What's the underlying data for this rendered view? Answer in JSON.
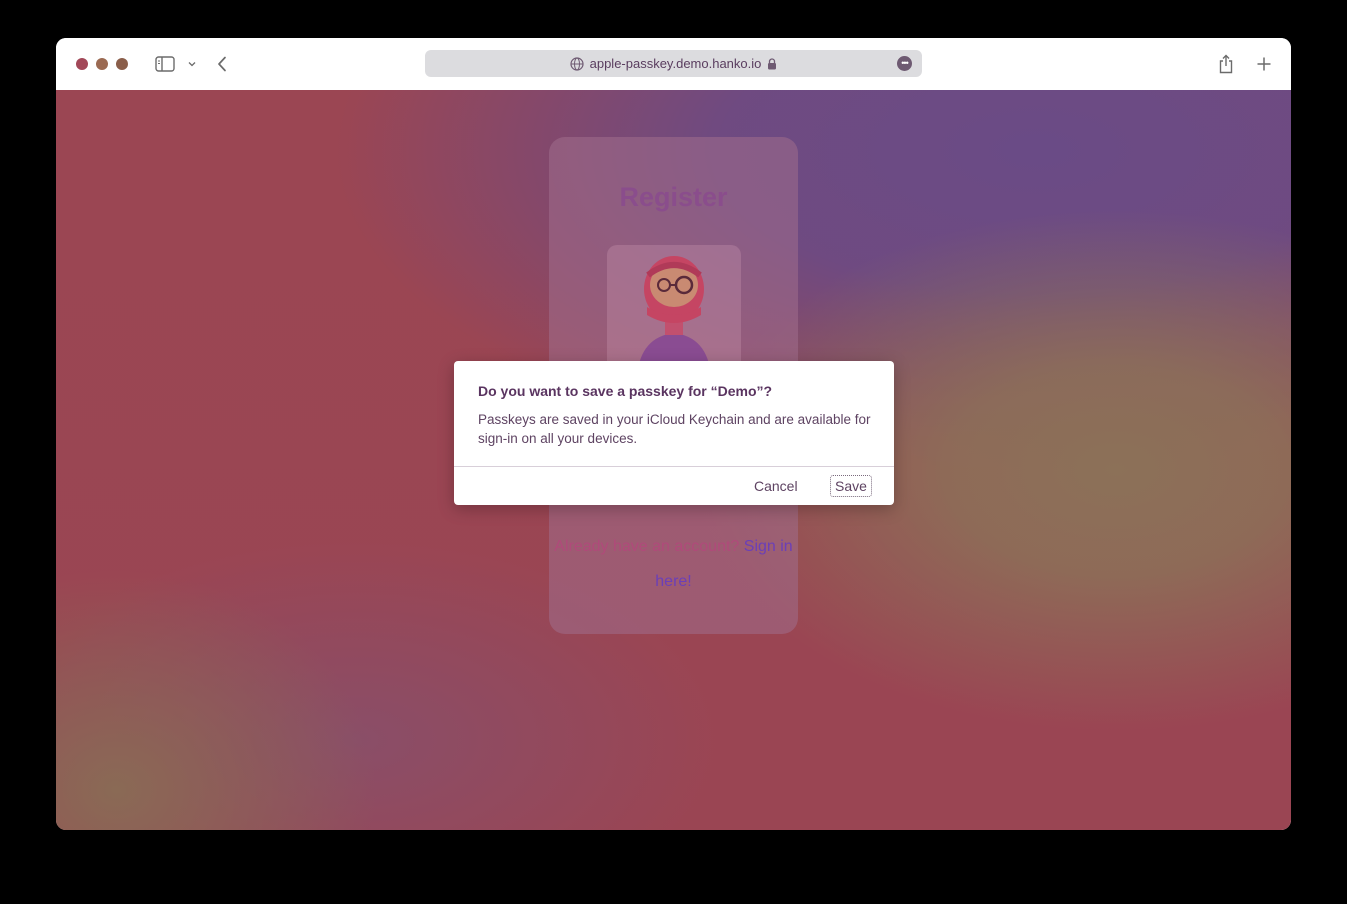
{
  "browser": {
    "url": "apple-passkey.demo.hanko.io",
    "icons": {
      "sidebar": "sidebar-icon",
      "chevron": "chevron-down-icon",
      "back": "back-arrow-icon",
      "site": "globe-icon",
      "lock": "lock-icon",
      "more": "more-icon",
      "share": "share-icon",
      "new_tab": "plus-icon"
    }
  },
  "page": {
    "card_title": "Register",
    "already_text": "Already have an account?",
    "signin_link": "Sign in here!"
  },
  "dialog": {
    "title": "Do you want to save a passkey for “Demo”?",
    "body": "Passkeys are saved in your iCloud Keychain and are available for sign-in on all your devices.",
    "cancel_label": "Cancel",
    "save_label": "Save"
  },
  "colors": {
    "background_red": "#9b4653",
    "background_purple": "#6a4b86",
    "background_tan": "#8c7158",
    "title": "#8a4d8c",
    "link": "#6b3fb8"
  }
}
